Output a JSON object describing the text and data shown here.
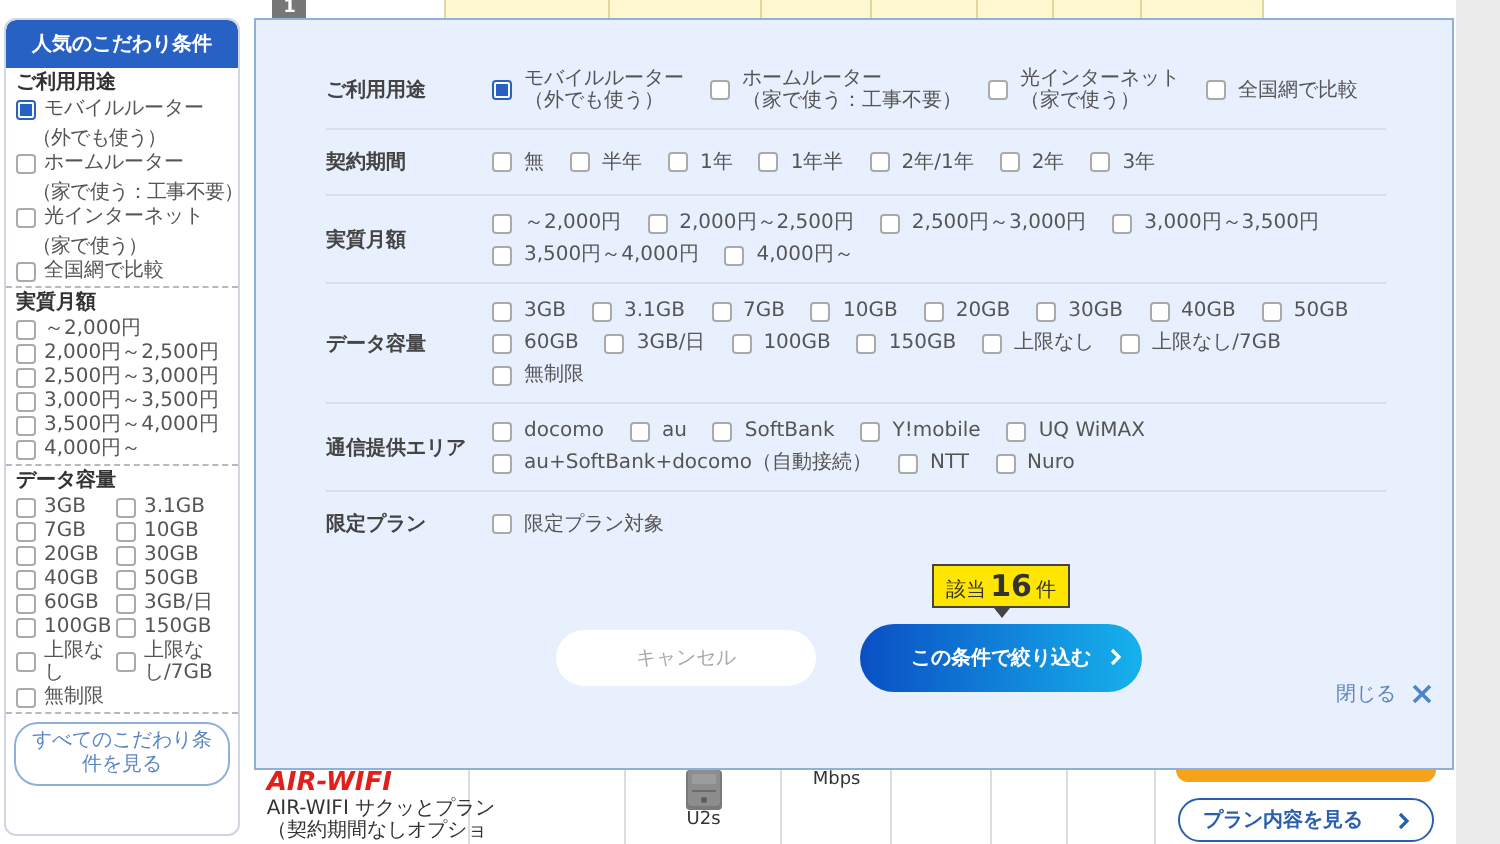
{
  "page_header": {
    "rank": "1"
  },
  "sidebar": {
    "title": "人気のこだわり条件",
    "sections": [
      {
        "heading": "ご利用用途",
        "options": [
          {
            "label": "モバイルルーター",
            "sub": "（外でも使う）",
            "checked": true
          },
          {
            "label": "ホームルーター",
            "sub": "（家で使う：工事不要）",
            "checked": false
          },
          {
            "label": "光インターネット",
            "sub": "（家で使う）",
            "checked": false
          },
          {
            "label": "全国網で比較",
            "checked": false
          }
        ]
      },
      {
        "heading": "実質月額",
        "options": [
          {
            "label": "～2,000円",
            "checked": false
          },
          {
            "label": "2,000円～2,500円",
            "checked": false
          },
          {
            "label": "2,500円～3,000円",
            "checked": false
          },
          {
            "label": "3,000円～3,500円",
            "checked": false
          },
          {
            "label": "3,500円～4,000円",
            "checked": false
          },
          {
            "label": "4,000円～",
            "checked": false
          }
        ]
      },
      {
        "heading": "データ容量",
        "options": [
          {
            "label": "3GB",
            "checked": false
          },
          {
            "label": "3.1GB",
            "checked": false
          },
          {
            "label": "7GB",
            "checked": false
          },
          {
            "label": "10GB",
            "checked": false
          },
          {
            "label": "20GB",
            "checked": false
          },
          {
            "label": "30GB",
            "checked": false
          },
          {
            "label": "40GB",
            "checked": false
          },
          {
            "label": "50GB",
            "checked": false
          },
          {
            "label": "60GB",
            "checked": false
          },
          {
            "label": "3GB/日",
            "checked": false
          },
          {
            "label": "100GB",
            "checked": false
          },
          {
            "label": "150GB",
            "checked": false
          },
          {
            "label": "上限なし",
            "checked": false
          },
          {
            "label": "上限なし/7GB",
            "checked": false
          },
          {
            "label": "無制限",
            "checked": false
          }
        ]
      }
    ],
    "button": "すべてのこだわり条件を見る"
  },
  "dialog": {
    "rows": [
      {
        "label": "ご利用用途",
        "options": [
          {
            "label": "モバイルルーター",
            "sub": "（外でも使う）",
            "checked": true
          },
          {
            "label": "ホームルーター",
            "sub": "（家で使う：工事不要）",
            "checked": false
          },
          {
            "label": "光インターネット",
            "sub": "（家で使う）",
            "checked": false
          },
          {
            "label": "全国網で比較",
            "checked": false
          }
        ]
      },
      {
        "label": "契約期間",
        "options": [
          {
            "label": "無",
            "checked": false
          },
          {
            "label": "半年",
            "checked": false
          },
          {
            "label": "1年",
            "checked": false
          },
          {
            "label": "1年半",
            "checked": false
          },
          {
            "label": "2年/1年",
            "checked": false
          },
          {
            "label": "2年",
            "checked": false
          },
          {
            "label": "3年",
            "checked": false
          }
        ]
      },
      {
        "label": "実質月額",
        "options": [
          {
            "label": "～2,000円",
            "checked": false
          },
          {
            "label": "2,000円～2,500円",
            "checked": false
          },
          {
            "label": "2,500円～3,000円",
            "checked": false
          },
          {
            "label": "3,000円～3,500円",
            "checked": false
          },
          {
            "label": "3,500円～4,000円",
            "checked": false
          },
          {
            "label": "4,000円～",
            "checked": false
          }
        ]
      },
      {
        "label": "データ容量",
        "options": [
          {
            "label": "3GB",
            "checked": false
          },
          {
            "label": "3.1GB",
            "checked": false
          },
          {
            "label": "7GB",
            "checked": false
          },
          {
            "label": "10GB",
            "checked": false
          },
          {
            "label": "20GB",
            "checked": false
          },
          {
            "label": "30GB",
            "checked": false
          },
          {
            "label": "40GB",
            "checked": false
          },
          {
            "label": "50GB",
            "checked": false
          },
          {
            "label": "60GB",
            "checked": false
          },
          {
            "label": "3GB/日",
            "checked": false
          },
          {
            "label": "100GB",
            "checked": false
          },
          {
            "label": "150GB",
            "checked": false
          },
          {
            "label": "上限なし",
            "checked": false
          },
          {
            "label": "上限なし/7GB",
            "checked": false
          },
          {
            "label": "無制限",
            "checked": false
          }
        ]
      },
      {
        "label": "通信提供エリア",
        "options": [
          {
            "label": "docomo",
            "checked": false
          },
          {
            "label": "au",
            "checked": false
          },
          {
            "label": "SoftBank",
            "checked": false
          },
          {
            "label": "Y!mobile",
            "checked": false
          },
          {
            "label": "UQ WiMAX",
            "checked": false
          },
          {
            "label": "au+SoftBank+docomo（自動接続）",
            "checked": false
          },
          {
            "label": "NTT",
            "checked": false
          },
          {
            "label": "Nuro",
            "checked": false
          }
        ]
      },
      {
        "label": "限定プラン",
        "options": [
          {
            "label": "限定プラン対象",
            "checked": false
          }
        ]
      }
    ],
    "result_badge": {
      "prefix": "該当",
      "count": "16",
      "suffix": "件"
    },
    "cancel_button": "キャンセル",
    "apply_button": "この条件で絞り込む",
    "close": "閉じる"
  },
  "listing": {
    "logo": "AIR-WIFI",
    "description_lines": [
      "AIR-WIFI サクッとプラン",
      "（契約期間なしオプショ"
    ],
    "device": "U2s",
    "speed_unit": "Mbps",
    "plan_button": "プラン内容を見る"
  }
}
